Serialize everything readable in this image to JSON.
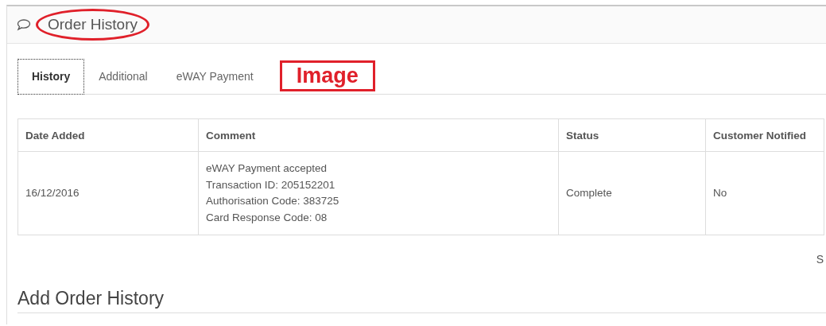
{
  "panel": {
    "title": "Order History",
    "title_annotated": true
  },
  "tabs": [
    {
      "label": "History",
      "selected": true
    },
    {
      "label": "Additional",
      "selected": false
    },
    {
      "label": "eWAY Payment",
      "selected": false
    }
  ],
  "annotation": {
    "label": "Image"
  },
  "table": {
    "columns": [
      "Date Added",
      "Comment",
      "Status",
      "Customer Notified"
    ],
    "rows": [
      {
        "cells": [
          "16/12/2016",
          [
            "eWAY Payment accepted",
            "Transaction ID: 205152201",
            "Authorisation Code: 383725",
            "Card Response Code: 08"
          ],
          "Complete",
          "No"
        ]
      }
    ]
  },
  "pagination_text": "S",
  "section_title": "Add Order History"
}
